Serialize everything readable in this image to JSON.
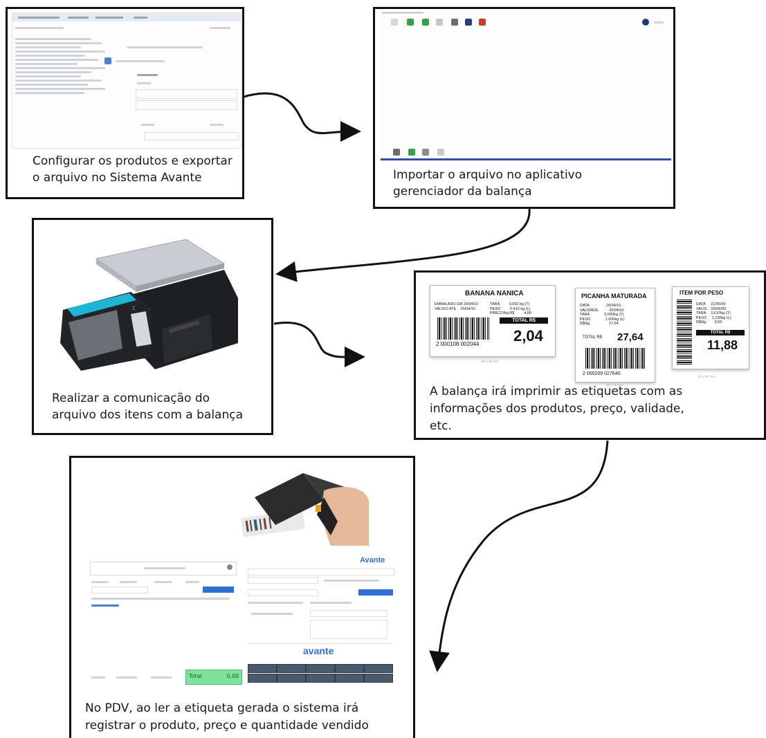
{
  "steps": [
    {
      "caption_line1": "Configurar os produtos e exportar",
      "caption_line2": "o arquivo no Sistema Avante"
    },
    {
      "caption_line1": "Importar o arquivo no aplicativo",
      "caption_line2": "gerenciador da balança"
    },
    {
      "caption_line1": "Realizar a comunicação do",
      "caption_line2": "arquivo dos itens com a balança"
    },
    {
      "caption_line1": "A balança irá imprimir as etiquetas com as",
      "caption_line2": "informações dos produtos, preço, validade,",
      "caption_line3": "etc."
    },
    {
      "caption_line1": "No PDV, ao ler a etiqueta gerada o sistema irá",
      "caption_line2": "registrar o produto, preço e quantidade vendido"
    }
  ],
  "labels": [
    {
      "title": "BANANA NANICA",
      "left_info": "EMBALADO EM 20/04/10\nVALIDO ATE    20/04/10",
      "right_info": "TARA         0,002 kg (T)\nPESO         0,410 kg (L)\nPRECO/kg R$         4,99",
      "total_label": "TOTAL R$",
      "barcode_number": "2 000108 002044",
      "total_value": "2,04",
      "size": "60 x 40 mm"
    },
    {
      "title": "PICANHA MATURADA",
      "info": "DATA                20/04/10\nVALIDADE          20/04/10\nTARA              0,000kg (T)\nPESO              1,000kg (L)\nR$/kg                  27,64",
      "total_label": "TOTAL R$",
      "total_value": "27,64",
      "barcode_number": "2 000209 027640",
      "size": "40 x 60 mm"
    },
    {
      "title": "ITEM POR PESO",
      "info": "DATA     21/05/09\nVALID.   02/06/09\nTARA     0,010kg (T)\nPESO     1,230kg (L)\nR$/kg        9,66",
      "total_label": "TOTAL R$",
      "total_value": "11,88",
      "size": "40 x 60 mm"
    }
  ],
  "pdv": {
    "brand_top": "Avante",
    "brand_bottom": "avante",
    "total_label": "Total",
    "total_value": "0,00"
  },
  "colors": {
    "frame": "#111111",
    "arrow": "#111111",
    "accent_blue": "#2f6fd6",
    "pdv_green": "#7de39a",
    "pdv_button": "#4a5a6e"
  }
}
